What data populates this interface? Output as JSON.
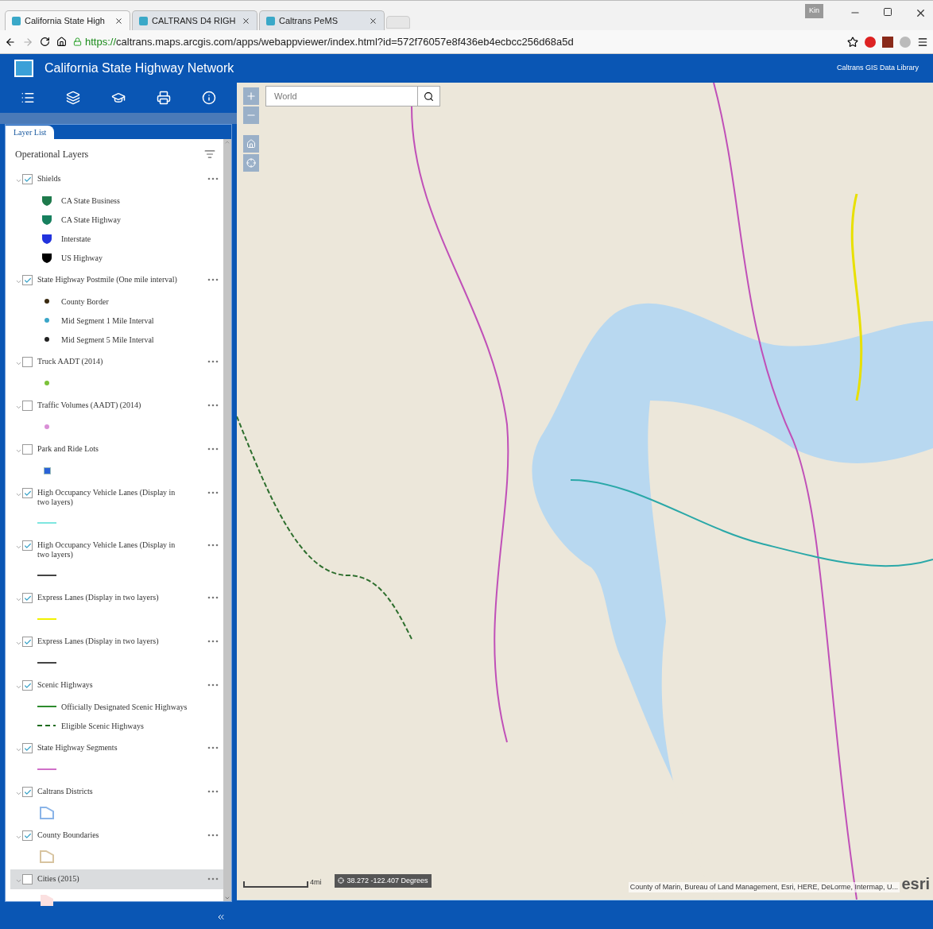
{
  "browser": {
    "tabs": [
      {
        "title": "California State High",
        "selected": true
      },
      {
        "title": "CALTRANS D4 RIGH",
        "selected": false
      },
      {
        "title": "Caltrans PeMS",
        "selected": false
      }
    ],
    "user": "Kin",
    "url_secure": "https://",
    "url_rest": "caltrans.maps.arcgis.com/apps/webappviewer/index.html?id=572f76057e8f436eb4ecbcc256d68a5d"
  },
  "app": {
    "title": "California State Highway Network",
    "link": "Caltrans GIS Data Library"
  },
  "panel": {
    "tab": "Layer List",
    "heading": "Operational Layers",
    "layers": [
      {
        "label": "Shields",
        "checked": true,
        "selected": false,
        "legend": [
          {
            "kind": "shield",
            "color": "#1e7a4c",
            "label": "CA State Business"
          },
          {
            "kind": "shield",
            "color": "#17805e",
            "label": "CA State Highway"
          },
          {
            "kind": "shield",
            "color": "#2233dd",
            "label": "Interstate"
          },
          {
            "kind": "shield",
            "color": "#000000",
            "label": "US Highway"
          }
        ]
      },
      {
        "label": "State Highway Postmile (One mile interval)",
        "checked": true,
        "selected": false,
        "legend": [
          {
            "kind": "point",
            "color": "#3a2a10",
            "label": "County Border"
          },
          {
            "kind": "point",
            "color": "#3aa6c8",
            "label": "Mid Segment 1 Mile Interval"
          },
          {
            "kind": "point",
            "color": "#222222",
            "label": "Mid Segment 5 Mile Interval"
          }
        ]
      },
      {
        "label": "Truck AADT (2014)",
        "checked": false,
        "selected": false,
        "legend": [
          {
            "kind": "point",
            "color": "#7cc23a"
          }
        ]
      },
      {
        "label": "Traffic Volumes (AADT) (2014)",
        "checked": false,
        "selected": false,
        "legend": [
          {
            "kind": "point",
            "color": "#d98fd6"
          }
        ]
      },
      {
        "label": "Park and Ride Lots",
        "checked": false,
        "selected": false,
        "legend": [
          {
            "kind": "marker",
            "color": "#2a62d8"
          }
        ]
      },
      {
        "label": "High Occupancy Vehicle Lanes (Display in two layers)",
        "checked": true,
        "selected": false,
        "legend": [
          {
            "kind": "line",
            "color": "#7ee6e0"
          }
        ]
      },
      {
        "label": "High Occupancy Vehicle Lanes (Display in two layers)",
        "checked": true,
        "selected": false,
        "legend": [
          {
            "kind": "line",
            "color": "#444444"
          }
        ]
      },
      {
        "label": "Express Lanes (Display in two layers)",
        "checked": true,
        "selected": false,
        "legend": [
          {
            "kind": "line",
            "color": "#f2f200"
          }
        ]
      },
      {
        "label": "Express Lanes (Display in two layers)",
        "checked": true,
        "selected": false,
        "legend": [
          {
            "kind": "line",
            "color": "#444444"
          }
        ]
      },
      {
        "label": "Scenic Highways",
        "checked": true,
        "selected": false,
        "legend": [
          {
            "kind": "line",
            "color": "#2e8b2e",
            "label": "Officially Designated Scenic Highways"
          },
          {
            "kind": "dashed",
            "color": "#1e6b1e",
            "label": "Eligible Scenic Highways"
          }
        ]
      },
      {
        "label": "State Highway Segments",
        "checked": true,
        "selected": false,
        "legend": [
          {
            "kind": "line",
            "color": "#d070c8"
          }
        ]
      },
      {
        "label": "Caltrans Districts",
        "checked": true,
        "selected": false,
        "legend": [
          {
            "kind": "polygon",
            "color": "#8ab4e8"
          }
        ]
      },
      {
        "label": "County Boundaries",
        "checked": true,
        "selected": false,
        "legend": [
          {
            "kind": "polygon",
            "color": "#d8c4a0"
          }
        ]
      },
      {
        "label": "Cities (2015)",
        "checked": false,
        "selected": true,
        "legend": [
          {
            "kind": "fill",
            "color": "#fbe0e0"
          }
        ]
      }
    ]
  },
  "map": {
    "search_placeholder": "World",
    "scale": "4mi",
    "coordinates": "38.272 -122.407 Degrees",
    "attribution": "County of Marin, Bureau of Land Management, Esri, HERE, DeLorme, Intermap, U...",
    "logo": "esri"
  }
}
